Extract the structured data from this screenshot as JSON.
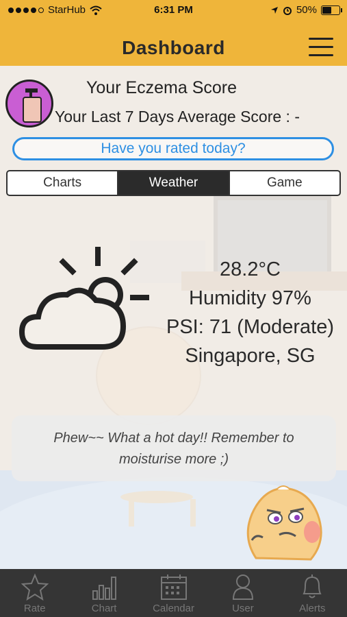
{
  "status_bar": {
    "carrier": "StarHub",
    "time": "6:31 PM",
    "battery": "50%"
  },
  "header": {
    "title": "Dashboard"
  },
  "score": {
    "title": "Your Eczema Score",
    "average_label": "Your Last 7 Days Average Score : -",
    "rate_prompt": "Have you rated today?"
  },
  "tabs": [
    {
      "label": "Charts",
      "active": false
    },
    {
      "label": "Weather",
      "active": true
    },
    {
      "label": "Game",
      "active": false
    }
  ],
  "weather": {
    "temperature": "28.2°C",
    "humidity": "Humidity 97%",
    "psi": "PSI: 71 (Moderate)",
    "location": "Singapore, SG",
    "icon": "partly-cloudy-icon"
  },
  "message": {
    "line1": "Phew~~ What a hot day!! Remember to",
    "line2": "moisturise more ;)"
  },
  "tabbar": [
    {
      "label": "Rate",
      "icon": "star-icon"
    },
    {
      "label": "Chart",
      "icon": "bar-chart-icon"
    },
    {
      "label": "Calendar",
      "icon": "calendar-icon"
    },
    {
      "label": "User",
      "icon": "user-icon"
    },
    {
      "label": "Alerts",
      "icon": "bell-icon"
    }
  ],
  "colors": {
    "header": "#efb53a",
    "accent_blue": "#2d8fe3",
    "tabbar": "#353535"
  }
}
